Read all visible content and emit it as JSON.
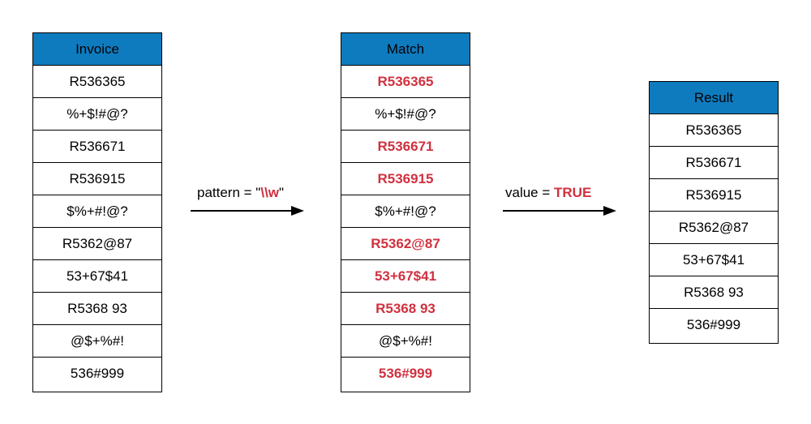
{
  "tables": {
    "invoice": {
      "header": "Invoice",
      "rows": [
        {
          "text": "R536365"
        },
        {
          "text": "%+$!#@?"
        },
        {
          "text": "R536671"
        },
        {
          "text": "R536915"
        },
        {
          "text": "$%+#!@?"
        },
        {
          "text": "R5362@87"
        },
        {
          "text": "53+67$41"
        },
        {
          "text": "R5368 93"
        },
        {
          "text": "@$+%#!"
        },
        {
          "text": "536#999"
        }
      ]
    },
    "match": {
      "header": "Match",
      "rows": [
        {
          "text": "R536365",
          "matched": true
        },
        {
          "text": "%+$!#@?",
          "matched": false
        },
        {
          "text": "R536671",
          "matched": true
        },
        {
          "text": "R536915",
          "matched": true
        },
        {
          "text": "$%+#!@?",
          "matched": false
        },
        {
          "text": "R5362@87",
          "matched": true
        },
        {
          "text": "53+67$41",
          "matched": true
        },
        {
          "text": "R5368 93",
          "matched": true
        },
        {
          "text": "@$+%#!",
          "matched": false
        },
        {
          "text": "536#999",
          "matched": true
        }
      ]
    },
    "result": {
      "header": "Result",
      "rows": [
        {
          "text": "R536365"
        },
        {
          "text": "R536671"
        },
        {
          "text": "R536915"
        },
        {
          "text": "R5362@87"
        },
        {
          "text": "53+67$41"
        },
        {
          "text": "R5368 93"
        },
        {
          "text": "536#999"
        }
      ]
    }
  },
  "arrows": {
    "pattern": {
      "prefix": "pattern = \"",
      "value": "\\\\w",
      "suffix": "\""
    },
    "value": {
      "prefix": "value = ",
      "value": "TRUE"
    }
  },
  "colors": {
    "header": "#0f7bbf",
    "highlight": "#d0313f"
  }
}
